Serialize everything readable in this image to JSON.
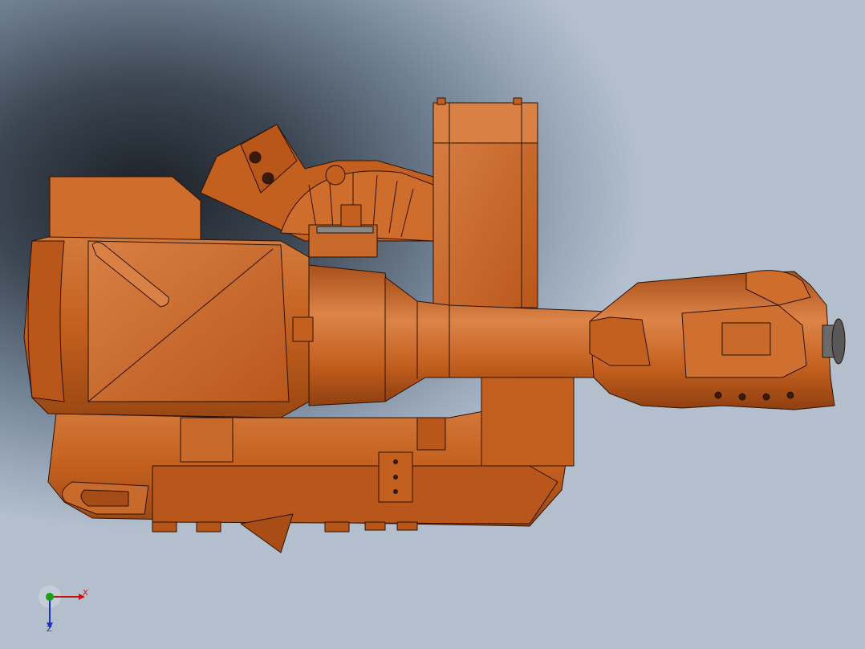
{
  "viewport": {
    "background_top": "#8b9db1",
    "background_bottom": "#b9c4d2",
    "shadow_color": "#1b2026"
  },
  "model": {
    "body_color": "#c4601f",
    "body_highlight": "#d98045",
    "body_shadow": "#8f3f10",
    "edge_color": "#2a1206",
    "flange_color": "#5a5a5a"
  },
  "triad": {
    "x_label": "X",
    "z_label": "Z",
    "x_color": "#c81010",
    "y_color": "#19a019",
    "z_color": "#1a2fd0"
  }
}
